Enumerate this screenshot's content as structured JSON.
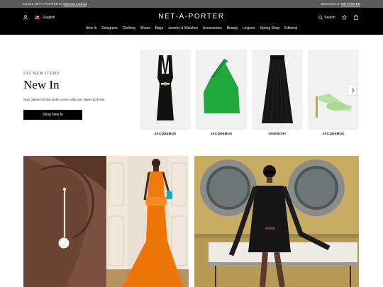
{
  "promo": {
    "left_text": "Explore NET-A-PORTER on",
    "left_link": "iOS and Android",
    "right_text": "Menswear on",
    "right_link": "MR PORTER"
  },
  "header": {
    "logo": "NET-A-PORTER",
    "language": "English",
    "search_label": "Search",
    "icons": [
      "user-icon",
      "flag-icon",
      "search-icon",
      "star-icon",
      "shopping-bag-icon"
    ]
  },
  "nav": {
    "items": [
      "New In",
      "Designers",
      "Clothing",
      "Shoes",
      "Bags",
      "Jewelry & Watches",
      "Accessories",
      "Beauty",
      "Lingerie",
      "Spring Shop",
      "Editorial"
    ]
  },
  "new_in": {
    "eyebrow": "910 NEW ITEMS",
    "title": "New In",
    "subtitle": "Stay ahead of the style curve with our latest arrivals",
    "button": "Shop New In"
  },
  "products": [
    {
      "brand": "JACQUEMUS"
    },
    {
      "brand": "JACQUEMUS"
    },
    {
      "brand": "GIVENCHY"
    },
    {
      "brand": "JACQUEMUS"
    }
  ],
  "colors": {
    "header_bg": "#000000",
    "promo_bg": "#5b5b5b",
    "product_bg": "#efefef",
    "green_top": "#1fa83c",
    "orange_gown": "#f07a10",
    "mint_heel": "#b6e2a1"
  }
}
